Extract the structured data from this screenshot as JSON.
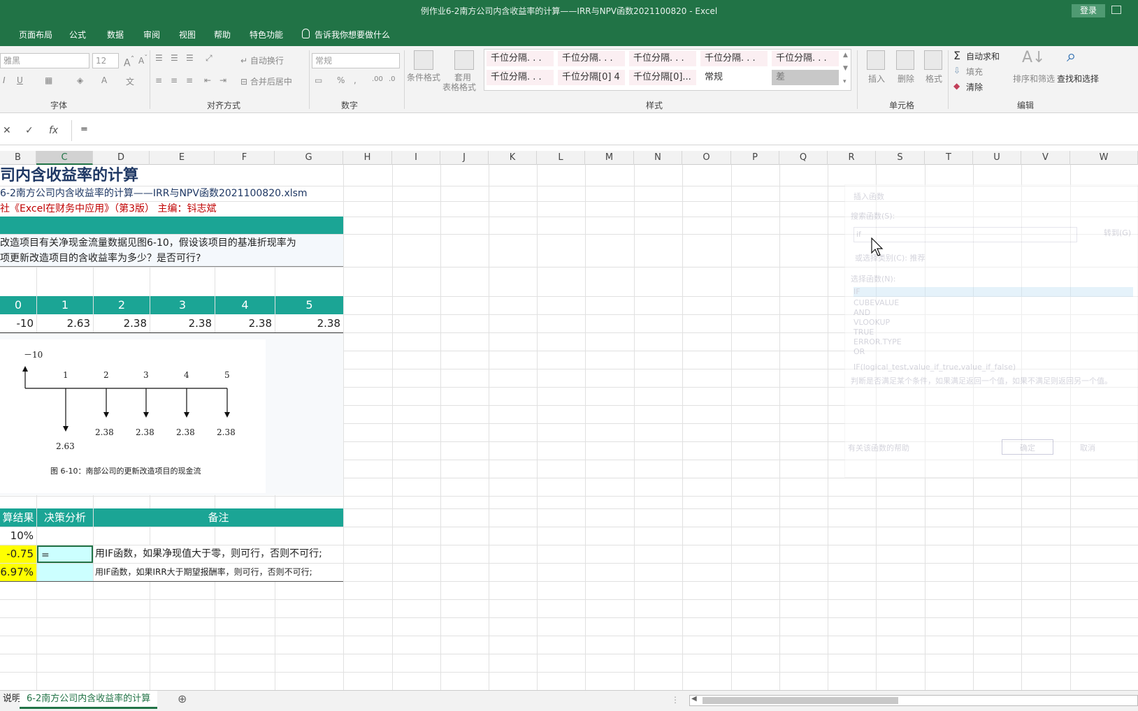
{
  "window": {
    "title": "例作业6-2南方公司内含收益率的计算——IRR与NPV函数2021100820  -  Excel",
    "login_label": "登录"
  },
  "tabs": {
    "page_layout": "页面布局",
    "formulas": "公式",
    "data": "数据",
    "review": "审阅",
    "view": "视图",
    "help": "帮助",
    "special": "特色功能",
    "tell_me": "告诉我你想要做什么"
  },
  "ribbon": {
    "font_name": "雅黑",
    "font_size": "12",
    "wrap_text": "自动换行",
    "merge_center": "合并后居中",
    "number_format": "常规",
    "cond_format": "条件格式",
    "table_format_1": "套用",
    "table_format_2": "表格格式",
    "insert": "插入",
    "delete": "删除",
    "format": "格式",
    "autosum": "自动求和",
    "fill": "填充",
    "clear": "清除",
    "sort_filter": "排序和筛选",
    "find_select": "查找和选择",
    "groups": {
      "font": "字体",
      "alignment": "对齐方式",
      "number": "数字",
      "styles": "样式",
      "cells": "单元格",
      "editing": "编辑"
    },
    "styles": [
      "千位分隔. . .",
      "千位分隔. . .",
      "千位分隔. . .",
      "千位分隔. . .",
      "千位分隔. . .",
      "千位分隔. . .",
      "千位分隔[0] 4",
      "千位分隔[0]...",
      "常规",
      "差"
    ]
  },
  "formula_bar": {
    "value": "="
  },
  "columns": [
    "B",
    "C",
    "D",
    "E",
    "F",
    "G",
    "H",
    "I",
    "J",
    "K",
    "L",
    "M",
    "N",
    "O",
    "P",
    "Q",
    "R",
    "S",
    "T",
    "U",
    "V",
    "W"
  ],
  "sheet": {
    "title": "司内含收益率的计算",
    "filename": "6-2南方公司内含收益率的计算——IRR与NPV函数2021100820.xlsm",
    "source": "社《Excel在财务中应用》（第3版）  主编：钭志斌",
    "question_line1": "改造项目有关净现金流量数据见图6-10，假设该项目的基准折现率为",
    "question_line2": "项更新改造项目的含收益率为多少？是否可行?",
    "years": [
      "0",
      "1",
      "2",
      "3",
      "4",
      "5"
    ],
    "cashflows": [
      "-10",
      "2.63",
      "2.38",
      "2.38",
      "2.38",
      "2.38"
    ],
    "diagram": {
      "top_value": "－10",
      "periods": [
        "1",
        "2",
        "3",
        "4",
        "5"
      ],
      "flows": [
        "2.63",
        "2.38",
        "2.38",
        "2.38",
        "2.38"
      ],
      "caption": "图 6-10：南部公司的更新改造项目的现金流"
    },
    "result_header": "算结果",
    "decision_header": "决策分析",
    "note_header": "备注",
    "rate": "10%",
    "npv": "-0.75",
    "irr": "6.97%",
    "active_cell_value": "=",
    "note1": "用IF函数，如果净现值大于零，则可行，否则不可行;",
    "note2": "用IF函数，如果IRR大于期望报酬率，则可行，否则不可行;"
  },
  "dialog": {
    "title": "插入函数",
    "search_label": "搜索函数(S):",
    "search_value": "if",
    "go_button": "转到(G)",
    "category": "或选择类别(C): 推荐",
    "select_label": "选择函数(N):",
    "functions": [
      "IF",
      "CUBEVALUE",
      "AND",
      "VLOOKUP",
      "TRUE",
      "ERROR.TYPE",
      "OR"
    ],
    "signature": "IF(logical_test,value_if_true,value_if_false)",
    "description": "判断是否满足某个条件，如果满足返回一个值，如果不满足则返回另一个值。",
    "help_link": "有关该函数的帮助",
    "ok": "确定",
    "cancel": "取消"
  },
  "sheet_tabs": {
    "prev": "说明",
    "active": "6-2南方公司内含收益率的计算",
    "add": "⊕"
  }
}
